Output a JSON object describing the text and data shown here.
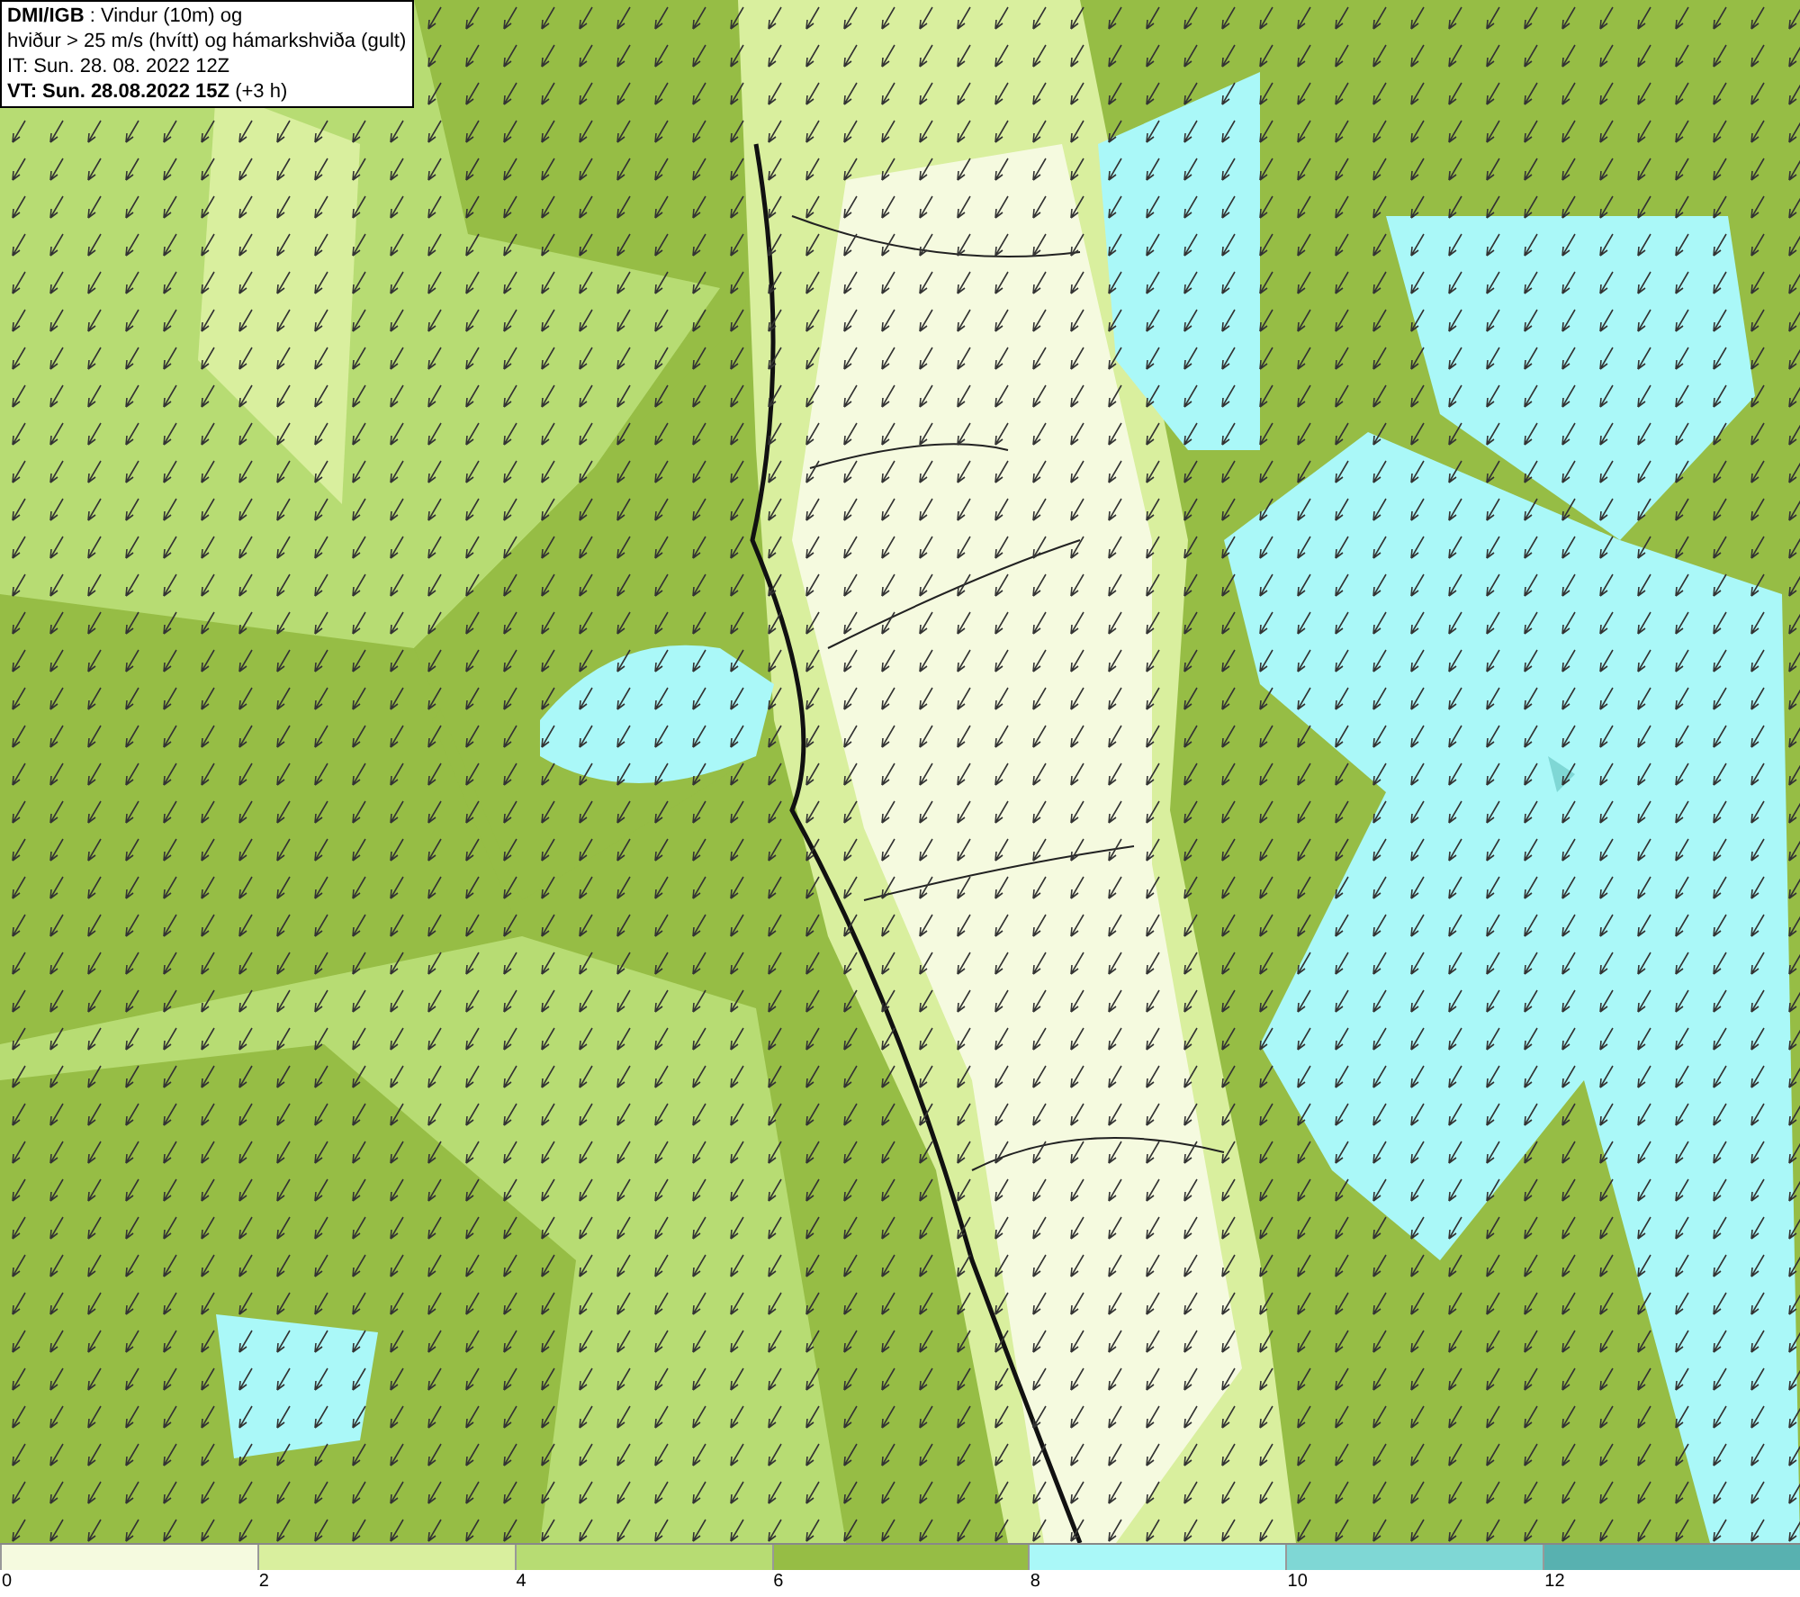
{
  "header": {
    "lines": [
      "**DMI/IGB** : Vindur (10m) og",
      "hviður > 25 m/s (hvítt) og hámarkshviða (gult)",
      "IT: Sun. 28. 08. 2022 12Z",
      "**VT: Sun. 28.08.2022 15Z** (+3 h)"
    ]
  },
  "legend": [
    {
      "label": "0",
      "color": "#f5fadf"
    },
    {
      "label": "2",
      "color": "#d9ef9e"
    },
    {
      "label": "4",
      "color": "#b7dc73"
    },
    {
      "label": "6",
      "color": "#96bd45"
    },
    {
      "label": "8",
      "color": "#aaf8f8"
    },
    {
      "label": "10",
      "color": "#7fd7d5"
    },
    {
      "label": "12",
      "color": "#58b1b0"
    }
  ]
}
